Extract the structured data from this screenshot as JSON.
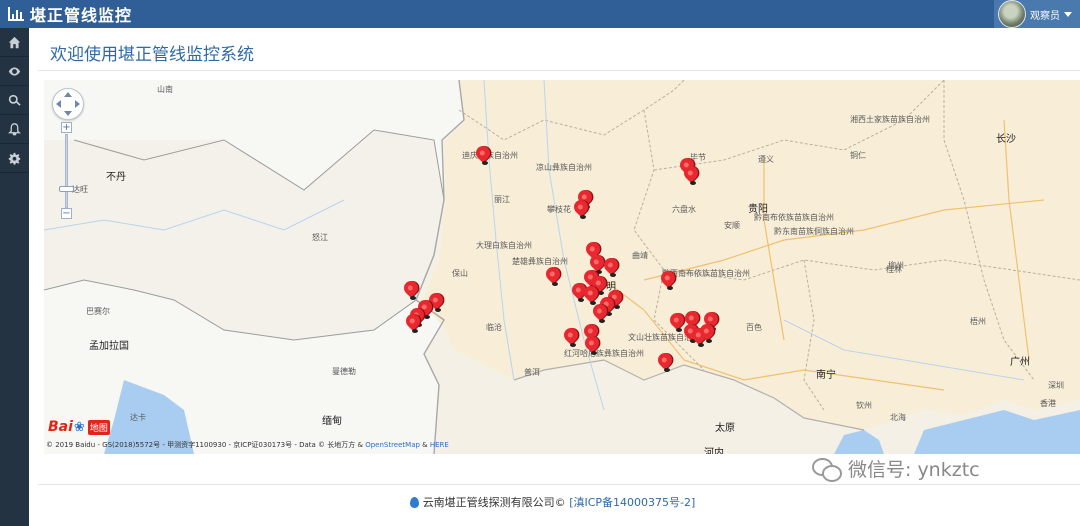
{
  "header": {
    "title": "堪正管线监控",
    "icon": "bar-chart-icon"
  },
  "user": {
    "name": "观察员",
    "icon": "caret-down-icon"
  },
  "sidebar": {
    "items": [
      {
        "icon": "home-icon"
      },
      {
        "icon": "eye-icon"
      },
      {
        "icon": "search-icon"
      },
      {
        "icon": "bell-icon"
      },
      {
        "icon": "gear-icon"
      }
    ]
  },
  "main": {
    "page_title": "欢迎使用堪正管线监控系统"
  },
  "map": {
    "logo": {
      "text_a": "Bai",
      "text_b": "地图"
    },
    "copyright": {
      "text": "© 2019 Baidu - GS(2018)5572号 - 甲测资字1100930 - 京ICP证030173号 - Data © 长地万方 & ",
      "osm": "OpenStreetMap",
      "amp": " & ",
      "here": "HERE"
    },
    "labels": {
      "bhutan": "不丹",
      "bangladesh": "孟加拉国",
      "myanmar": "缅甸",
      "guiyang": "贵阳",
      "kunming": "明",
      "nanning": "南宁",
      "guangzhou": "广州",
      "changsha": "长沙",
      "hanoi": "河内",
      "taiyuan": "太原",
      "hongkong": "香港",
      "barisal": "巴赛尔",
      "shannan": "山南",
      "qianxinan": "黔西南布依族苗族自治州",
      "honghe": "红河哈尼族彝族自治州",
      "wenshan": "文山壮族苗族自治州",
      "dali": "大理白族自治州",
      "chuxiong": "楚雄彝族自治州",
      "qiandongnan": "黔东南苗族侗族自治州",
      "qiannan": "黔南布依族苗族自治州",
      "liangshan": "凉山彝族自治州",
      "lijiang": "丽江",
      "panzhihua": "攀枝花",
      "qujing": "曲靖",
      "baoshan": "保山",
      "lincang": "临沧",
      "puer": "普洱",
      "baise": "百色",
      "liuzhou": "柳州",
      "guilin": "桂林",
      "wuzhou": "梧州",
      "qinzhou": "钦州",
      "beihai": "北海",
      "shenzhen": "深圳",
      "xiangxi": "湘西土家族苗族自治州",
      "diqing": "迪庆藏族自治州",
      "nujiang": "怒江",
      "dhaka": "达卡",
      "mandalay": "曼德勒",
      "tezpur": "达旺",
      "zunyi": "遵义",
      "tongren": "铜仁",
      "anshun": "安顺",
      "liupanshui": "六盘水",
      "bijie": "毕节"
    }
  },
  "footer": {
    "company": "云南堪正管线探测有限公司©",
    "icp": "[滇ICP备14000375号-2]"
  },
  "watermark": {
    "text": "微信号: ynkztc"
  }
}
